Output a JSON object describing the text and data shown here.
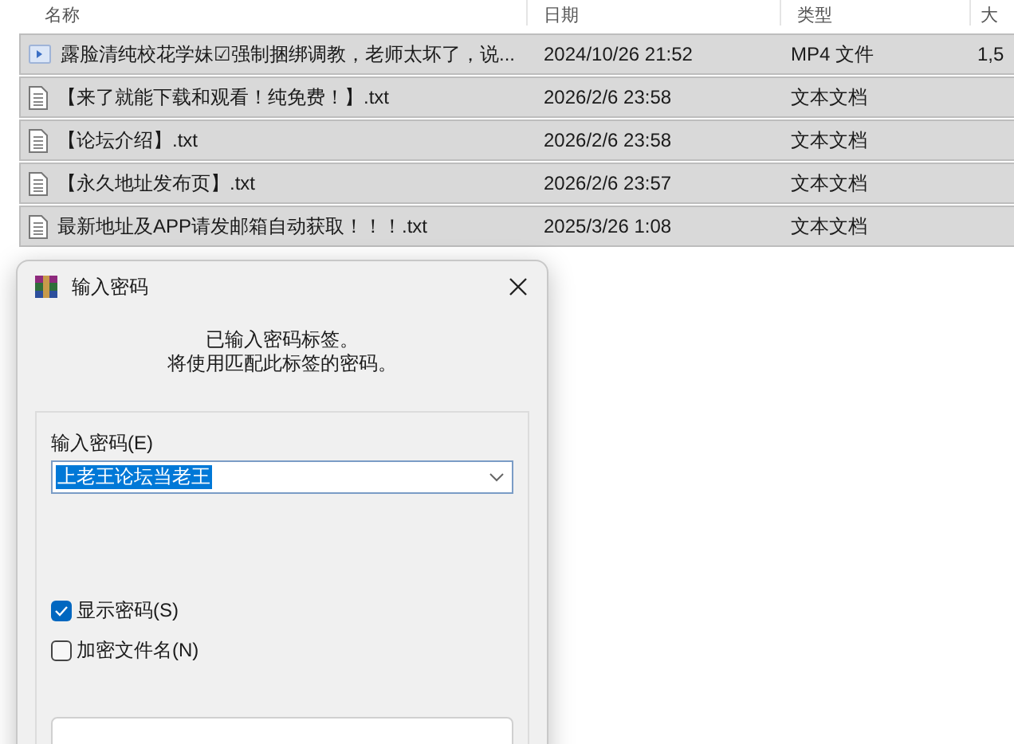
{
  "file_list": {
    "columns": [
      "名称",
      "日期",
      "类型",
      "大"
    ],
    "rows": [
      {
        "kind": "video",
        "name": "露脸清纯校花学妹☑强制捆绑调教，老师太坏了，说...",
        "date": "2024/10/26 21:52",
        "type": "MP4 文件",
        "size": "1,5"
      },
      {
        "kind": "text",
        "name": "【来了就能下载和观看！纯免费！】.txt",
        "date": "2026/2/6 23:58",
        "type": "文本文档"
      },
      {
        "kind": "text",
        "name": "【论坛介绍】.txt",
        "date": "2026/2/6 23:58",
        "type": "文本文档"
      },
      {
        "kind": "text",
        "name": "【永久地址发布页】.txt",
        "date": "2026/2/6 23:57",
        "type": "文本文档"
      },
      {
        "kind": "text",
        "name": "最新地址及APP请发邮箱自动获取！！！.txt",
        "date": "2025/3/26 1:08",
        "type": "文本文档"
      }
    ]
  },
  "dialog": {
    "title": "输入密码",
    "message": [
      "已输入密码标签。",
      "将使用匹配此标签的密码。"
    ],
    "password_label": "输入密码(E)",
    "password_value": "上老王论坛当老王",
    "options": [
      {
        "label": "显示密码(S)",
        "checked": true
      },
      {
        "label": "加密文件名(N)",
        "checked": false
      }
    ]
  }
}
